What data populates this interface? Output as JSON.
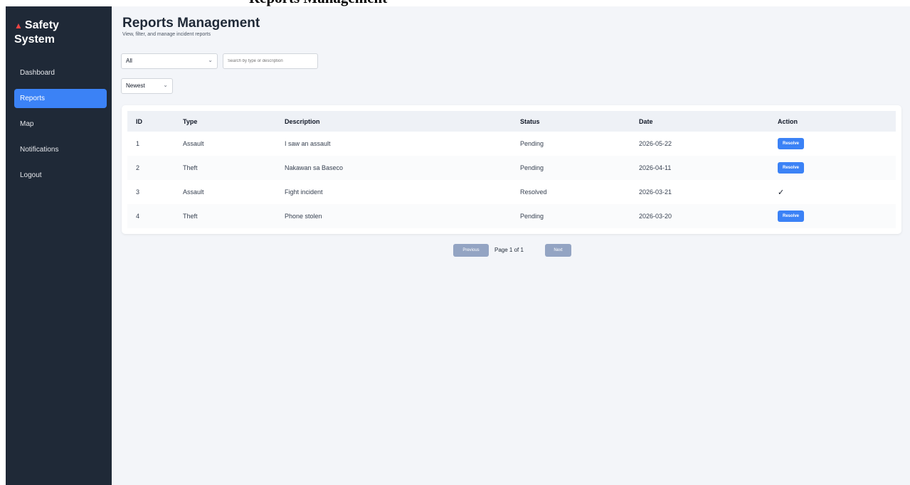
{
  "window": {
    "heading": "Reports Management"
  },
  "sidebar": {
    "brand": "Safety System",
    "brand_icon": "warning-icon",
    "items": [
      {
        "label": "Dashboard",
        "active": false
      },
      {
        "label": "Reports",
        "active": true
      },
      {
        "label": "Map",
        "active": false
      },
      {
        "label": "Notifications",
        "active": false
      },
      {
        "label": "Logout",
        "active": false
      }
    ]
  },
  "main": {
    "title": "Reports Management",
    "subtitle": "View, filter, and manage incident reports",
    "filter": {
      "value": "All"
    },
    "search": {
      "placeholder": "Search by type or description"
    },
    "sort": {
      "value": "Newest"
    }
  },
  "table": {
    "headers": [
      "ID",
      "Type",
      "Description",
      "Status",
      "Date",
      "Action"
    ],
    "rows": [
      {
        "id": "1",
        "type": "Assault",
        "description": "I saw an assault",
        "status": "Pending",
        "date": "2026-05-22",
        "action": "Resolve"
      },
      {
        "id": "2",
        "type": "Theft",
        "description": "Nakawan sa Baseco",
        "status": "Pending",
        "date": "2026-04-11",
        "action": "Resolve"
      },
      {
        "id": "3",
        "type": "Assault",
        "description": "Fight incident",
        "status": "Resolved",
        "date": "2026-03-21",
        "action": "✓"
      },
      {
        "id": "4",
        "type": "Theft",
        "description": "Phone stolen",
        "status": "Pending",
        "date": "2026-03-20",
        "action": "Resolve"
      }
    ]
  },
  "pagination": {
    "previous": "Previous",
    "label": "Page 1 of 1",
    "next": "Next"
  },
  "colors": {
    "sidebar": "#1f2937",
    "accent": "#3b82f6",
    "background": "#f3f5f9"
  }
}
